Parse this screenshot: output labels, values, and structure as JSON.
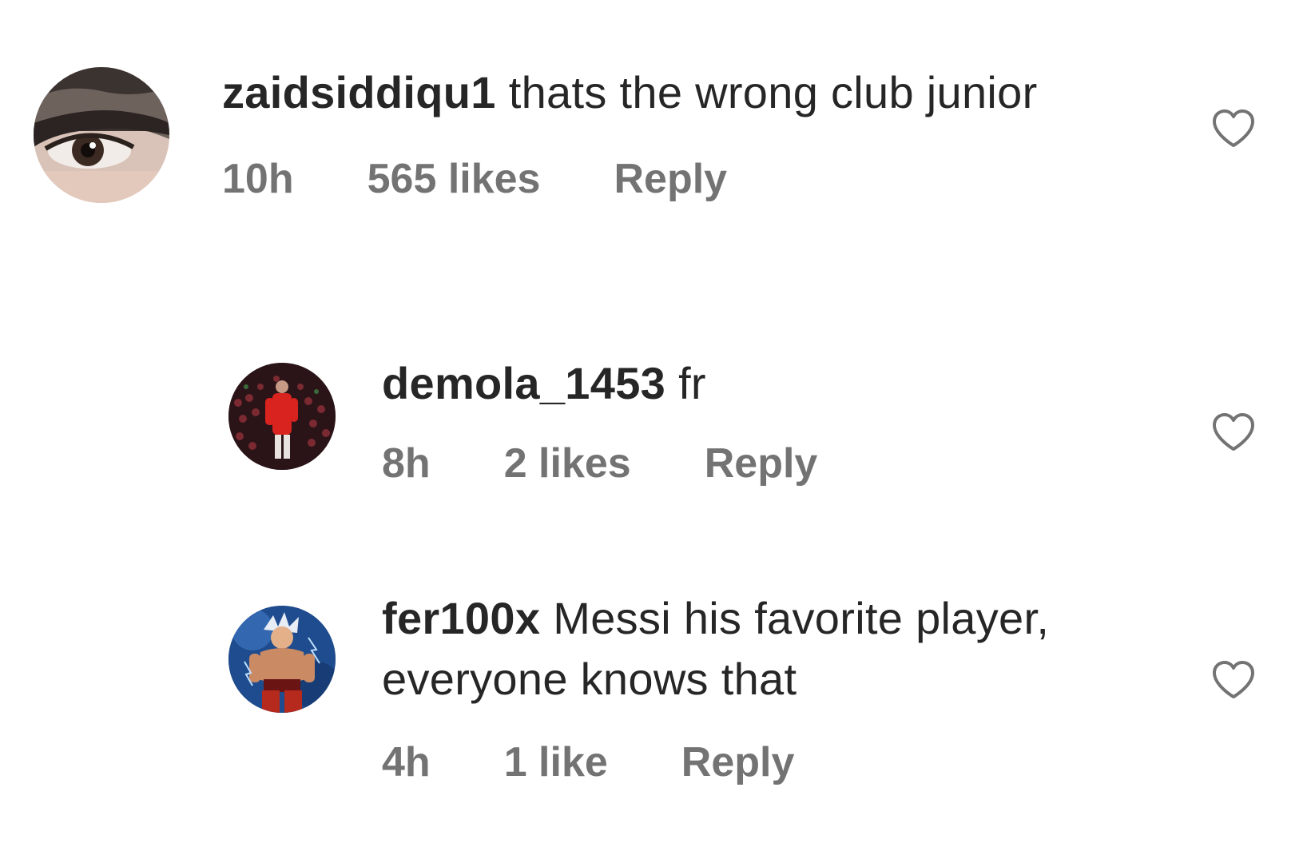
{
  "comments": [
    {
      "username": "zaidsiddiqu1",
      "text": "thats the wrong club junior",
      "time": "10h",
      "likes": "565 likes",
      "reply": "Reply",
      "avatar_icon": "eye-photo-avatar"
    },
    {
      "username": "demola_1453",
      "text": "fr",
      "time": "8h",
      "likes": "2 likes",
      "reply": "Reply",
      "avatar_icon": "football-player-photo-avatar"
    },
    {
      "username": "fer100x",
      "text": "Messi his favorite player, everyone knows that",
      "time": "4h",
      "likes": "1 like",
      "reply": "Reply",
      "avatar_icon": "anime-character-avatar"
    }
  ],
  "colors": {
    "text": "#262626",
    "meta": "#737373",
    "heart_outline": "#737373",
    "background": "#ffffff"
  }
}
